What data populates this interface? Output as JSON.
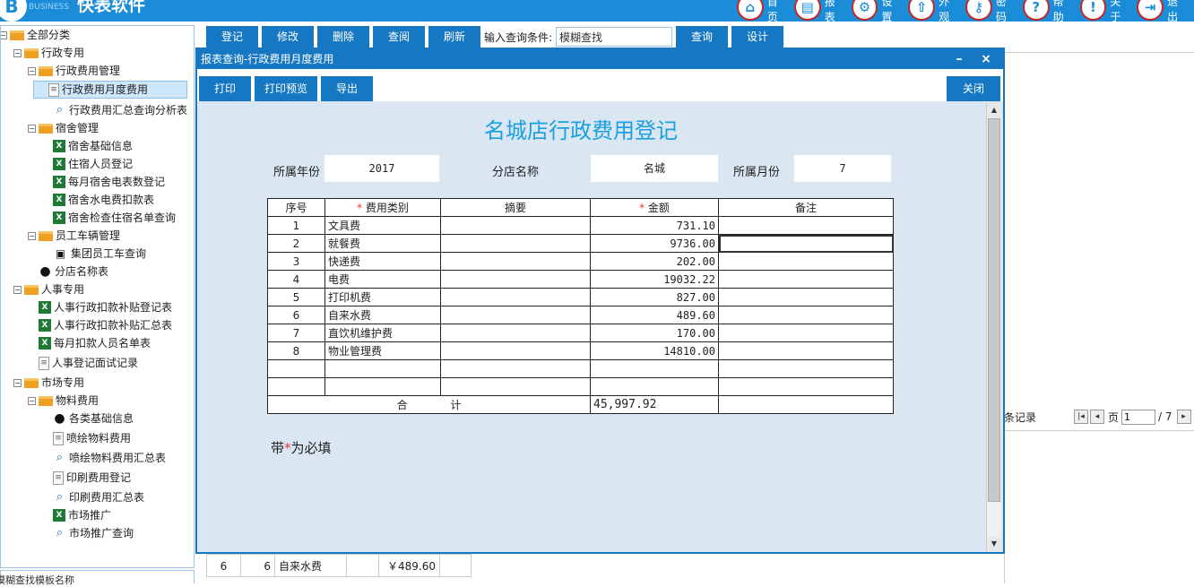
{
  "app": {
    "logo_letter": "B",
    "logo_sub": "BUSINESS",
    "title": "快表软件"
  },
  "topnav": [
    {
      "label": "首页",
      "glyph": "⌂"
    },
    {
      "label": "报表",
      "glyph": "▤"
    },
    {
      "label": "设置",
      "glyph": "⚙"
    },
    {
      "label": "外观",
      "glyph": "⇧"
    },
    {
      "label": "密码",
      "glyph": "⚷"
    },
    {
      "label": "帮助",
      "glyph": "?"
    },
    {
      "label": "关于",
      "glyph": "!"
    },
    {
      "label": "退出",
      "glyph": "⇥"
    }
  ],
  "tree": [
    {
      "label": "全部分类",
      "icon": "folder",
      "toggle": "⊟",
      "level": 0
    },
    {
      "label": "行政专用",
      "icon": "folder",
      "toggle": "⊟",
      "level": 1
    },
    {
      "label": "行政费用管理",
      "icon": "folder",
      "toggle": "⊟",
      "level": 2
    },
    {
      "label": "行政费用月度费用",
      "icon": "doc",
      "level": 3,
      "selected": true
    },
    {
      "label": "行政费用汇总查询分析表",
      "icon": "search",
      "level": 3
    },
    {
      "label": "宿舍管理",
      "icon": "folder",
      "toggle": "⊟",
      "level": 2
    },
    {
      "label": "宿舍基础信息",
      "icon": "excel",
      "level": 3
    },
    {
      "label": "住宿人员登记",
      "icon": "excel",
      "level": 3
    },
    {
      "label": "每月宿舍电表数登记",
      "icon": "excel",
      "level": 3
    },
    {
      "label": "宿舍水电费扣款表",
      "icon": "excel",
      "level": 3
    },
    {
      "label": "宿舍检查住宿名单查询",
      "icon": "excel",
      "level": 3
    },
    {
      "label": "员工车辆管理",
      "icon": "folder",
      "toggle": "⊟",
      "level": 2
    },
    {
      "label": "集团员工车查询",
      "icon": "car",
      "level": 3
    },
    {
      "label": "分店名称表",
      "icon": "person",
      "level": 2
    },
    {
      "label": "人事专用",
      "icon": "folder",
      "toggle": "⊟",
      "level": 1
    },
    {
      "label": "人事行政扣款补贴登记表",
      "icon": "excel",
      "level": 2
    },
    {
      "label": "人事行政扣款补贴汇总表",
      "icon": "excel",
      "level": 2
    },
    {
      "label": "每月扣款人员名单表",
      "icon": "excel",
      "level": 2
    },
    {
      "label": "人事登记面试记录",
      "icon": "doc",
      "level": 2
    },
    {
      "label": "市场专用",
      "icon": "folder",
      "toggle": "⊟",
      "level": 1
    },
    {
      "label": "物料费用",
      "icon": "folder",
      "toggle": "⊟",
      "level": 2
    },
    {
      "label": "各类基础信息",
      "icon": "person",
      "level": 3
    },
    {
      "label": "喷绘物料费用",
      "icon": "doc",
      "level": 3
    },
    {
      "label": "喷绘物料费用汇总表",
      "icon": "search",
      "level": 3
    },
    {
      "label": "印刷费用登记",
      "icon": "doc",
      "level": 3
    },
    {
      "label": "印刷费用汇总表",
      "icon": "search",
      "level": 3
    },
    {
      "label": "市场推广",
      "icon": "excel",
      "level": 3
    },
    {
      "label": "市场推广查询",
      "icon": "search",
      "level": 3
    }
  ],
  "search_panel": {
    "label": "模糊查找模板名称"
  },
  "toolbar": {
    "buttons": [
      "登记",
      "修改",
      "删除",
      "查阅",
      "刷新"
    ],
    "query_label": "输入查询条件:",
    "query_value": "模糊查找",
    "query_button": "查询",
    "design_button": "设计"
  },
  "background": {
    "pager_label": "条记录",
    "page_label": "页",
    "page_value": "1",
    "page_total": "/ 7",
    "row": {
      "idx": "6",
      "no": "6",
      "name": "自来水费",
      "amount": "￥489.60"
    }
  },
  "dialog": {
    "title": "报表查询-行政费用月度费用",
    "min": "–",
    "close_x": "×",
    "buttons": {
      "print": "打印",
      "preview": "打印预览",
      "export": "导出",
      "close": "关闭"
    },
    "form_title": "名城店行政费用登记",
    "fields": {
      "year_label": "所属年份",
      "year": "2017",
      "store_label": "分店名称",
      "store": "名城",
      "month_label": "所属月份",
      "month": "7"
    },
    "table": {
      "headers": {
        "no": "序号",
        "category": "费用类别",
        "summary": "摘要",
        "amount": "金额",
        "remark": "备注"
      },
      "required_mark": "*",
      "rows": [
        {
          "no": "1",
          "category": "文具费",
          "summary": "",
          "amount": "731.10",
          "remark": ""
        },
        {
          "no": "2",
          "category": "就餐费",
          "summary": "",
          "amount": "9736.00",
          "remark": ""
        },
        {
          "no": "3",
          "category": "快递费",
          "summary": "",
          "amount": "202.00",
          "remark": ""
        },
        {
          "no": "4",
          "category": "电费",
          "summary": "",
          "amount": "19032.22",
          "remark": ""
        },
        {
          "no": "5",
          "category": "打印机费",
          "summary": "",
          "amount": "827.00",
          "remark": ""
        },
        {
          "no": "6",
          "category": "自来水费",
          "summary": "",
          "amount": "489.60",
          "remark": ""
        },
        {
          "no": "7",
          "category": "直饮机维护费",
          "summary": "",
          "amount": "170.00",
          "remark": ""
        },
        {
          "no": "8",
          "category": "物业管理费",
          "summary": "",
          "amount": "14810.00",
          "remark": ""
        },
        {
          "no": "",
          "category": "",
          "summary": "",
          "amount": "",
          "remark": ""
        },
        {
          "no": "",
          "category": "",
          "summary": "",
          "amount": "",
          "remark": ""
        }
      ],
      "total_label_1": "合",
      "total_label_2": "计",
      "total": "45,997.92"
    },
    "note_prefix": "带",
    "note_mark": "*",
    "note_suffix": "为必填"
  },
  "colors": {
    "accent": "#1678c2",
    "title_blue": "#1aa0e0",
    "required": "#e53935",
    "sheet_bg": "#dbe6f3"
  }
}
